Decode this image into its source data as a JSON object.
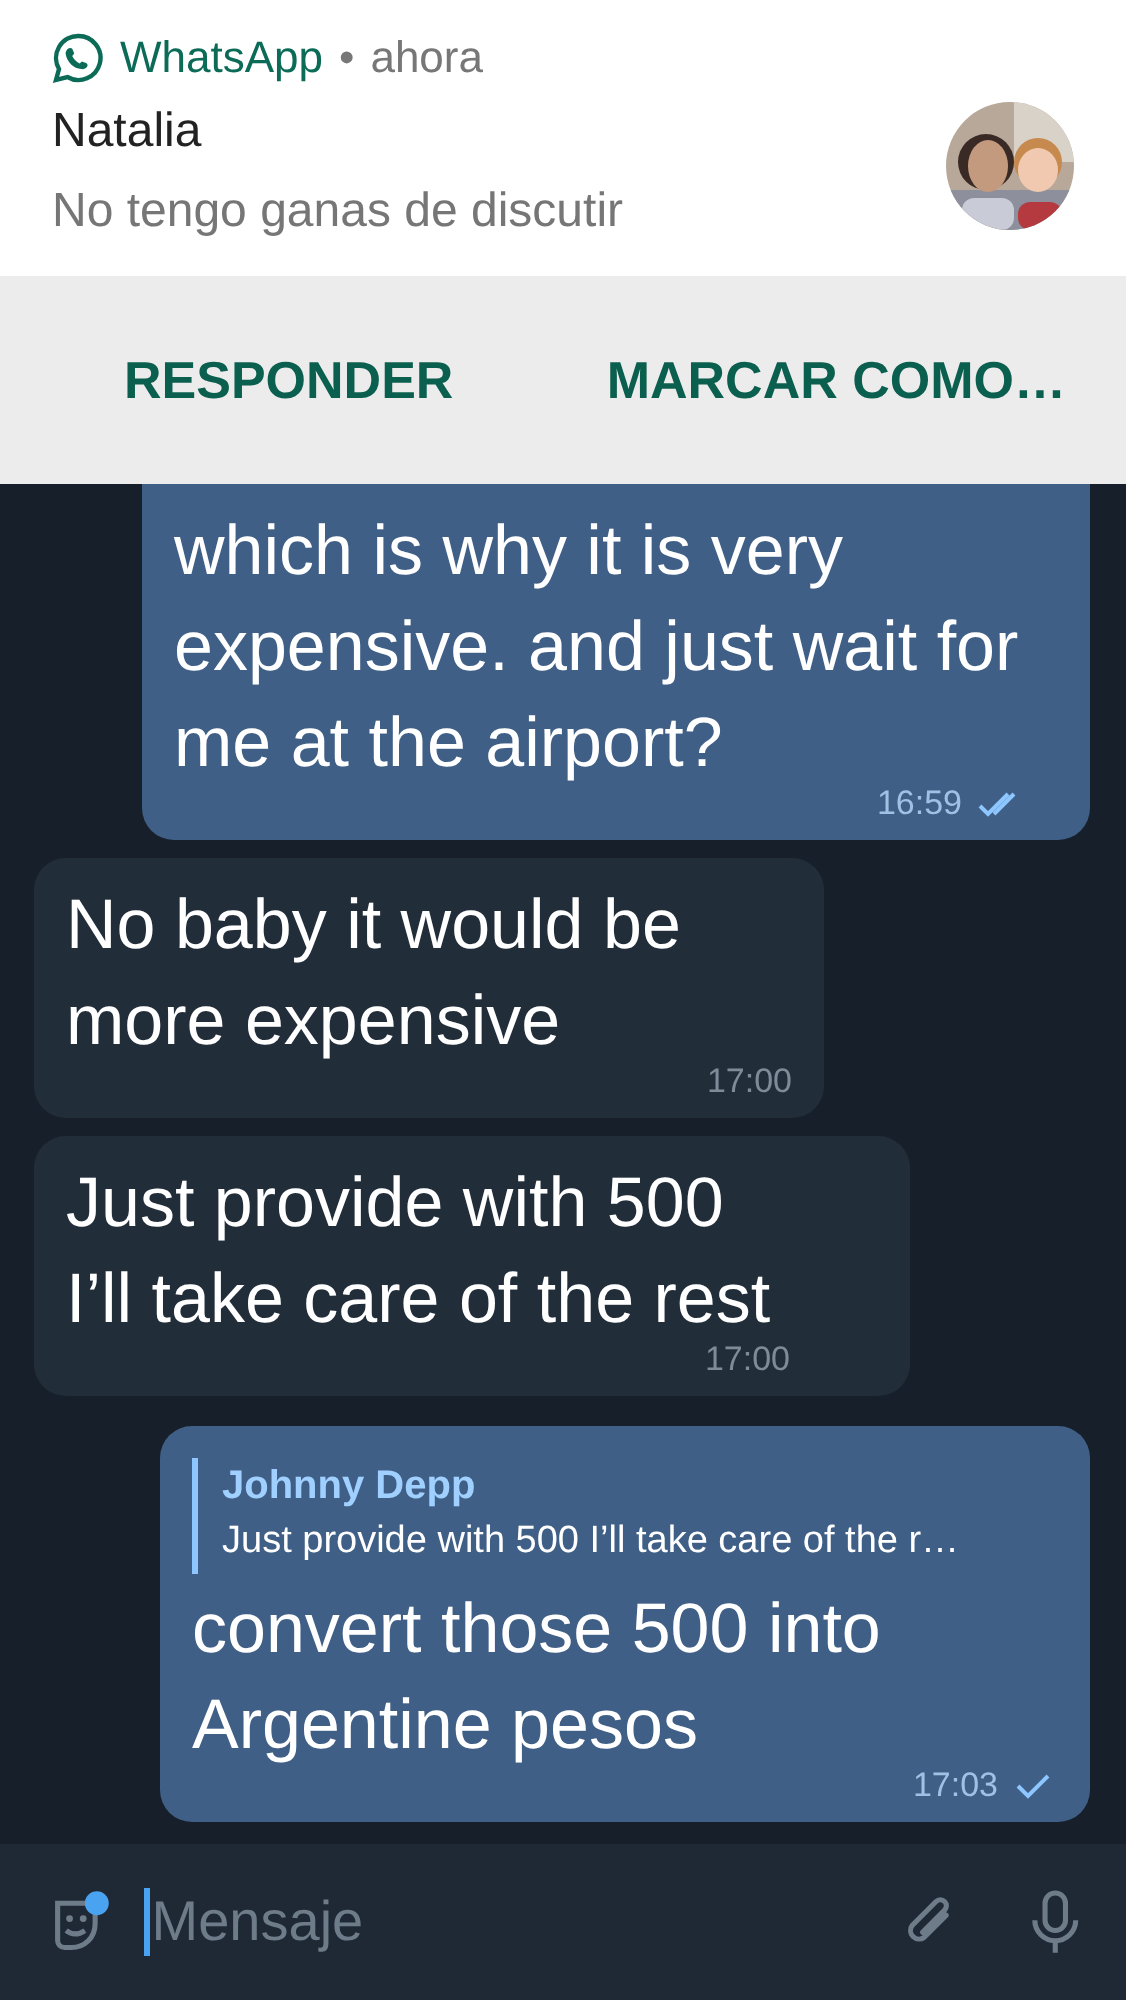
{
  "notification": {
    "app": "WhatsApp",
    "separator": "•",
    "time": "ahora",
    "sender": "Natalia",
    "text": "No tengo ganas de discutir",
    "actions": [
      "RESPONDER",
      "MARCAR COMO…"
    ]
  },
  "messages": [
    {
      "kind": "outgoing",
      "text": "which is why it is very expensive. and just wait for me at the airport?",
      "time": "16:59",
      "read": true,
      "top_cut": true
    },
    {
      "kind": "incoming",
      "text": "No baby it would be more expensive",
      "time": "17:00"
    },
    {
      "kind": "incoming",
      "text": "Just provide with 500 I’ll take care of the rest",
      "time": "17:00"
    },
    {
      "kind": "outgoing",
      "reply": {
        "author": "Johnny Depp",
        "text": "Just provide with 500 I’ll take care of the r…"
      },
      "text": "convert those 500 into Argentine pesos",
      "time": "17:03",
      "read": false
    }
  ],
  "composer": {
    "placeholder": "Mensaje"
  }
}
